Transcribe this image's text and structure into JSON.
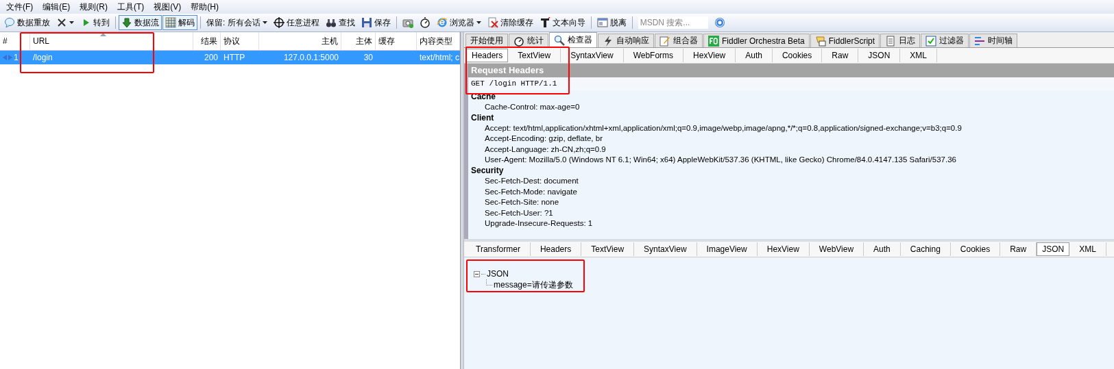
{
  "menu": [
    "文件(F)",
    "编辑(E)",
    "规则(R)",
    "工具(T)",
    "视图(V)",
    "帮助(H)"
  ],
  "toolbar": [
    {
      "kind": "button",
      "label": "数据重放",
      "pressed": false
    },
    {
      "kind": "dropdown",
      "pressed": false
    },
    {
      "kind": "button",
      "label": "转到",
      "pressed": false
    },
    {
      "kind": "separator"
    },
    {
      "kind": "button",
      "label": "数据流",
      "pressed": true
    },
    {
      "kind": "button",
      "label": "解码",
      "pressed": true
    },
    {
      "kind": "separator"
    },
    {
      "kind": "dropdown",
      "label": "保留: 所有会话",
      "pressed": false
    },
    {
      "kind": "button",
      "label": "任意进程",
      "pressed": false
    },
    {
      "kind": "button",
      "label": "查找",
      "pressed": false
    },
    {
      "kind": "button",
      "label": "保存",
      "pressed": false
    },
    {
      "kind": "separator"
    },
    {
      "kind": "button",
      "pressed": false
    },
    {
      "kind": "button",
      "pressed": false
    },
    {
      "kind": "dropdown",
      "label": "浏览器",
      "pressed": false
    },
    {
      "kind": "button",
      "label": "清除缓存",
      "pressed": false
    },
    {
      "kind": "button",
      "label": "文本向导",
      "pressed": false
    },
    {
      "kind": "separator"
    },
    {
      "kind": "button",
      "label": "脱离",
      "pressed": false
    },
    {
      "kind": "separator"
    },
    {
      "kind": "field",
      "placeholder": "MSDN 搜索..."
    },
    {
      "kind": "button",
      "pressed": false
    }
  ],
  "sessions": {
    "columns": [
      "#",
      "URL",
      "结果",
      "协议",
      "主机",
      "主体",
      "缓存",
      "内容类型"
    ],
    "rows": [
      {
        "selected": true,
        "cells": [
          "1",
          "/login",
          "200",
          "HTTP",
          "127.0.0.1:5000",
          "30",
          "",
          "text/html; c"
        ]
      }
    ]
  },
  "inspector_tabs": [
    {
      "label": "开始使用",
      "selected": false
    },
    {
      "label": "统计",
      "selected": false
    },
    {
      "label": "检查器",
      "selected": true
    },
    {
      "label": "自动响应",
      "selected": false
    },
    {
      "label": "组合器",
      "selected": false
    },
    {
      "label": "Fiddler Orchestra Beta",
      "selected": false
    },
    {
      "label": "FiddlerScript",
      "selected": false
    },
    {
      "label": "日志",
      "selected": false
    },
    {
      "label": "过滤器",
      "selected": false
    },
    {
      "label": "时间轴",
      "selected": false
    }
  ],
  "request_tabs": [
    {
      "label": "Headers",
      "selected": true
    },
    {
      "label": "TextView",
      "selected": false
    },
    {
      "label": "SyntaxView",
      "selected": false
    },
    {
      "label": "WebForms",
      "selected": false
    },
    {
      "label": "HexView",
      "selected": false
    },
    {
      "label": "Auth",
      "selected": false
    },
    {
      "label": "Cookies",
      "selected": false
    },
    {
      "label": "Raw",
      "selected": false
    },
    {
      "label": "JSON",
      "selected": false
    },
    {
      "label": "XML",
      "selected": false
    }
  ],
  "request_headers": {
    "title": "Request Headers",
    "request_line": "GET /login HTTP/1.1",
    "groups": [
      {
        "name": "Cache",
        "headers": [
          "Cache-Control: max-age=0"
        ]
      },
      {
        "name": "Client",
        "headers": [
          "Accept: text/html,application/xhtml+xml,application/xml;q=0.9,image/webp,image/apng,*/*;q=0.8,application/signed-exchange;v=b3;q=0.9",
          "Accept-Encoding: gzip, deflate, br",
          "Accept-Language: zh-CN,zh;q=0.9",
          "User-Agent: Mozilla/5.0 (Windows NT 6.1; Win64; x64) AppleWebKit/537.36 (KHTML, like Gecko) Chrome/84.0.4147.135 Safari/537.36"
        ]
      },
      {
        "name": "Security",
        "headers": [
          "Sec-Fetch-Dest: document",
          "Sec-Fetch-Mode: navigate",
          "Sec-Fetch-Site: none",
          "Sec-Fetch-User: ?1",
          "Upgrade-Insecure-Requests: 1"
        ]
      }
    ]
  },
  "response_tabs": [
    {
      "label": "Transformer",
      "selected": false
    },
    {
      "label": "Headers",
      "selected": false
    },
    {
      "label": "TextView",
      "selected": false
    },
    {
      "label": "SyntaxView",
      "selected": false
    },
    {
      "label": "ImageView",
      "selected": false
    },
    {
      "label": "HexView",
      "selected": false
    },
    {
      "label": "WebView",
      "selected": false
    },
    {
      "label": "Auth",
      "selected": false
    },
    {
      "label": "Caching",
      "selected": false
    },
    {
      "label": "Cookies",
      "selected": false
    },
    {
      "label": "Raw",
      "selected": false
    },
    {
      "label": "JSON",
      "selected": true
    },
    {
      "label": "XML",
      "selected": false
    }
  ],
  "json_tree": {
    "label": "JSON",
    "expanded": true,
    "children": [
      {
        "label": "message=请传递参数"
      }
    ]
  }
}
